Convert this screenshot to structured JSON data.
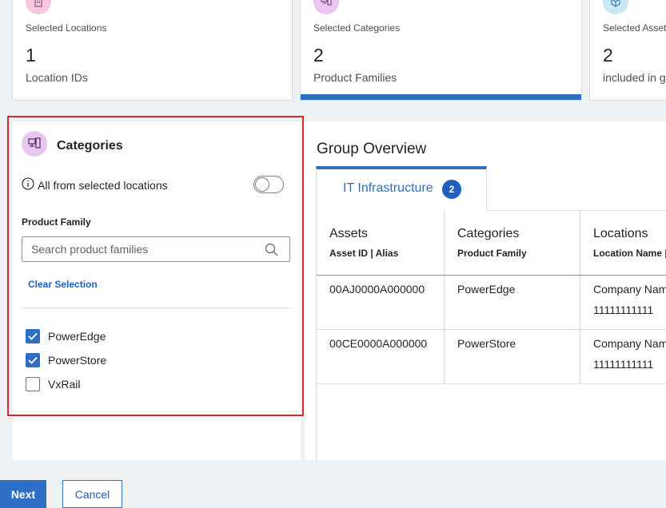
{
  "summary_cards": [
    {
      "label": "Selected Locations",
      "count": "1",
      "sublabel": "Location IDs",
      "icon": "building-icon",
      "icon_bg": "#f6c7df",
      "active": false
    },
    {
      "label": "Selected Categories",
      "count": "2",
      "sublabel": "Product Families",
      "icon": "computer-icon",
      "icon_bg": "#eac5f1",
      "active": true
    },
    {
      "label": "Selected Assets",
      "count": "2",
      "sublabel": "included in g",
      "icon": "cube-icon",
      "icon_bg": "#c8e7f7",
      "active": false
    }
  ],
  "categories_panel": {
    "title": "Categories",
    "icon": "computer-icon",
    "toggle_label": "All from selected locations",
    "toggle_on": false,
    "field_label": "Product Family",
    "search_placeholder": "Search product families",
    "search_value": "",
    "clear_label": "Clear Selection",
    "items": [
      {
        "label": "PowerEdge",
        "checked": true
      },
      {
        "label": "PowerStore",
        "checked": true
      },
      {
        "label": "VxRail",
        "checked": false
      }
    ]
  },
  "group_overview": {
    "title": "Group Overview",
    "tabs": [
      {
        "label": "IT Infrastructure",
        "badge": "2",
        "active": true
      }
    ],
    "table": {
      "columns": [
        {
          "title": "Assets",
          "subtitle": "Asset ID | Alias"
        },
        {
          "title": "Categories",
          "subtitle": "Product Family"
        },
        {
          "title": "Locations",
          "subtitle": "Location Name |"
        }
      ],
      "rows": [
        {
          "asset": "00AJ0000A000000",
          "category": "PowerEdge",
          "location_name": "Company Nam",
          "location_id": "11111111111"
        },
        {
          "asset": "00CE0000A000000",
          "category": "PowerStore",
          "location_name": "Company Nam",
          "location_id": "11111111111"
        }
      ]
    }
  },
  "footer": {
    "next_label": "Next",
    "cancel_label": "Cancel"
  },
  "colors": {
    "accent": "#2f6ec5",
    "link": "#1f5fbf",
    "highlight": "#e0262c"
  }
}
